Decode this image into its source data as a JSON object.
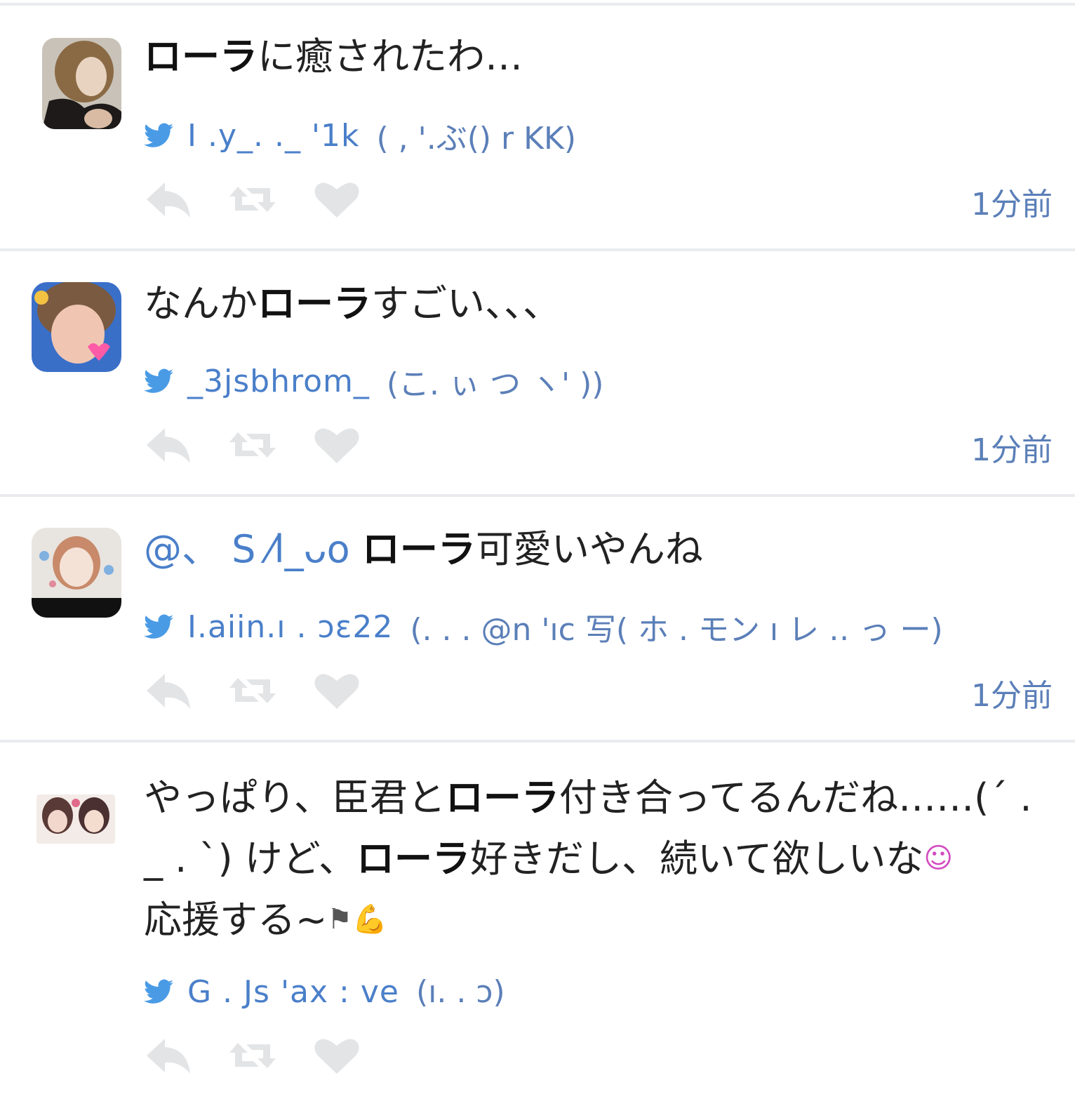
{
  "colors": {
    "link": "#4a7fc9",
    "separator": "#e9ebee",
    "action_icon": "#e3e4e6",
    "text": "#222222"
  },
  "tweets": [
    {
      "avatar": "avatar-photo",
      "text_parts": [
        {
          "t": "ローラ",
          "bold": true
        },
        {
          "t": "に癒されたわ…",
          "bold": false
        }
      ],
      "handle": "I  .y_.  ._ '1k",
      "display": "(  ,  '.ぶ()  r KK)",
      "time": "1分前"
    },
    {
      "avatar": "avatar-photo",
      "text_parts": [
        {
          "t": "なんか",
          "bold": false
        },
        {
          "t": "ローラ",
          "bold": true
        },
        {
          "t": "すごい、、、",
          "bold": false
        }
      ],
      "handle": "_3jsbhrom_",
      "display": "(こ. ぃ つ    ヽ' ))",
      "time": "1分前"
    },
    {
      "avatar": "avatar-drawing",
      "mention": "@、 S ⁄l_ᴗo",
      "text_parts": [
        {
          "t": "ローラ",
          "bold": true
        },
        {
          "t": "可愛いやんね",
          "bold": false
        }
      ],
      "handle": "I.aiin.ı . ɔɛ22",
      "display": "(. . .  @n  'ıc  写( ホ . モン ı レ ‥ っ ー)",
      "time": "1分前"
    },
    {
      "avatar": "avatar-pair",
      "text_parts": [
        {
          "t": "やっぱり、臣君と",
          "bold": false
        },
        {
          "t": "ローラ",
          "bold": true
        },
        {
          "t": "付き合ってるんだね……(´ . _ . `) けど、",
          "bold": false
        },
        {
          "t": "ローラ",
          "bold": true
        },
        {
          "t": "好きだし、続いて欲しいな",
          "bold": false
        }
      ],
      "text_line3": "応援する~",
      "emoji": {
        "smile": "☺",
        "flags": "⚑",
        "muscle": "💪"
      },
      "handle": "G . Js 'ax : ve",
      "display": "(ı. . ɔ)",
      "time": ""
    }
  ]
}
